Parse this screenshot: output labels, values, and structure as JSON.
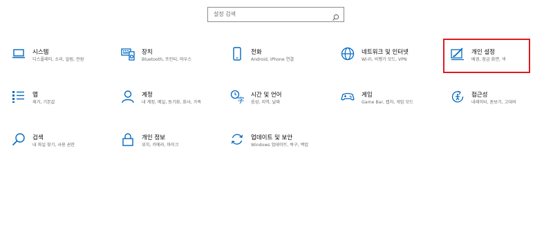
{
  "search": {
    "placeholder": "설정 검색",
    "icon": "search-icon"
  },
  "tiles": [
    {
      "title": "시스템",
      "desc": "디스플레이, 소리, 알림, 전원",
      "icon": "laptop-icon"
    },
    {
      "title": "장치",
      "desc": "Bluetooth, 프린터, 마우스",
      "icon": "keyboard-device-icon"
    },
    {
      "title": "전화",
      "desc": "Android, iPhone 연결",
      "icon": "phone-icon"
    },
    {
      "title": "네트워크 및 인터넷",
      "desc": "Wi-Fi, 비행기 모드, VPN",
      "icon": "globe-icon"
    },
    {
      "title": "개인 설정",
      "desc": "배경, 잠금 화면, 색",
      "icon": "personalization-icon"
    },
    {
      "title": "앱",
      "desc": "제거, 기본값",
      "icon": "apps-list-icon"
    },
    {
      "title": "계정",
      "desc": "내 계정, 메일, 동기화, 회사, 가족",
      "icon": "person-icon"
    },
    {
      "title": "시간 및 언어",
      "desc": "음성, 지역, 날짜",
      "icon": "time-language-icon"
    },
    {
      "title": "게임",
      "desc": "Game Bar, 캡처, 게임 모드",
      "icon": "gamepad-icon"
    },
    {
      "title": "접근성",
      "desc": "내레이터, 돋보기, 고대비",
      "icon": "accessibility-icon"
    },
    {
      "title": "검색",
      "desc": "내 파일 찾기, 사용 권한",
      "icon": "search-icon"
    },
    {
      "title": "개인 정보",
      "desc": "위치, 카메라, 마이크",
      "icon": "lock-icon"
    },
    {
      "title": "업데이트 및 보안",
      "desc": "Windows 업데이트, 복구, 백업",
      "icon": "refresh-icon"
    }
  ],
  "colors": {
    "accent": "#0067c0",
    "highlight": "#e0181e"
  }
}
